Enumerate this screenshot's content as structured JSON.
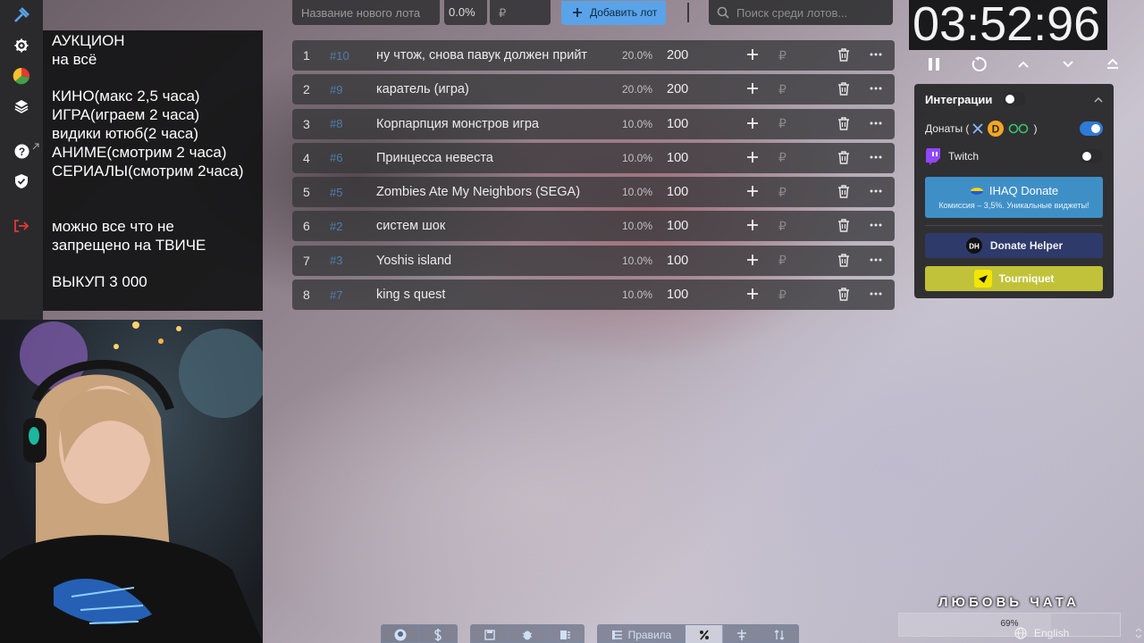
{
  "rules": {
    "lines": [
      "АУКЦИОН",
      "на всё",
      "",
      "КИНО(макс 2,5 часа)",
      "ИГРА(играем 2 часа)",
      "видики ютюб(2 часа)",
      "АНИМЕ(смотрим 2 часа)",
      "СЕРИАЛЫ(смотрим 2часа)",
      "",
      "",
      "можно все что не",
      "запрещено на ТВИЧЕ",
      "",
      "ВЫКУП 3 000"
    ]
  },
  "topbar": {
    "lot_placeholder": "Название нового лота",
    "percent_value": "0.0%",
    "amount_placeholder": "₽",
    "add_label": "Добавить лот",
    "search_placeholder": "Поиск среди лотов..."
  },
  "lots": [
    {
      "num": "1",
      "id": "#10",
      "name": "ну чтож, снова павук должен прийт",
      "pct": "20.0%",
      "amount": "200"
    },
    {
      "num": "2",
      "id": "#9",
      "name": "каратель (игра)",
      "pct": "20.0%",
      "amount": "200"
    },
    {
      "num": "3",
      "id": "#8",
      "name": "Корпарпция монстров игра",
      "pct": "10.0%",
      "amount": "100"
    },
    {
      "num": "4",
      "id": "#6",
      "name": "Принцесса невеста",
      "pct": "10.0%",
      "amount": "100"
    },
    {
      "num": "5",
      "id": "#5",
      "name": "Zombies Ate My Neighbors (SEGA)",
      "pct": "10.0%",
      "amount": "100"
    },
    {
      "num": "6",
      "id": "#2",
      "name": "систем шок",
      "pct": "10.0%",
      "amount": "100"
    },
    {
      "num": "7",
      "id": "#3",
      "name": "Yoshis island",
      "pct": "10.0%",
      "amount": "100"
    },
    {
      "num": "8",
      "id": "#7",
      "name": "king s quest",
      "pct": "10.0%",
      "amount": "100"
    }
  ],
  "lot_currency": "₽",
  "timer": {
    "value": "03:52:96"
  },
  "integrations": {
    "title": "Интеграции",
    "donations_label": "Донаты (",
    "donations_close": ")",
    "twitch_label": "Twitch",
    "ihaq_title": "IHAQ Donate",
    "ihaq_subtitle": "Комиссия – 3,5%. Уникальные виджеты!",
    "donate_helper": "Donate Helper",
    "tourniquet": "Tourniquet"
  },
  "bottombar": {
    "rules_label": "Правила"
  },
  "overlay": {
    "love_chat": "ЛЮБОВЬ ЧАТА",
    "progress_label": "69%",
    "progress_fraction": 0.69,
    "language": "English"
  },
  "colors": {
    "accent": "#5aa3e8",
    "toggle_on": "#2f7bd6",
    "ihaq": "#3f8fc7",
    "donate_helper": "#2e3a6a",
    "tourniquet": "#c2c23a"
  }
}
